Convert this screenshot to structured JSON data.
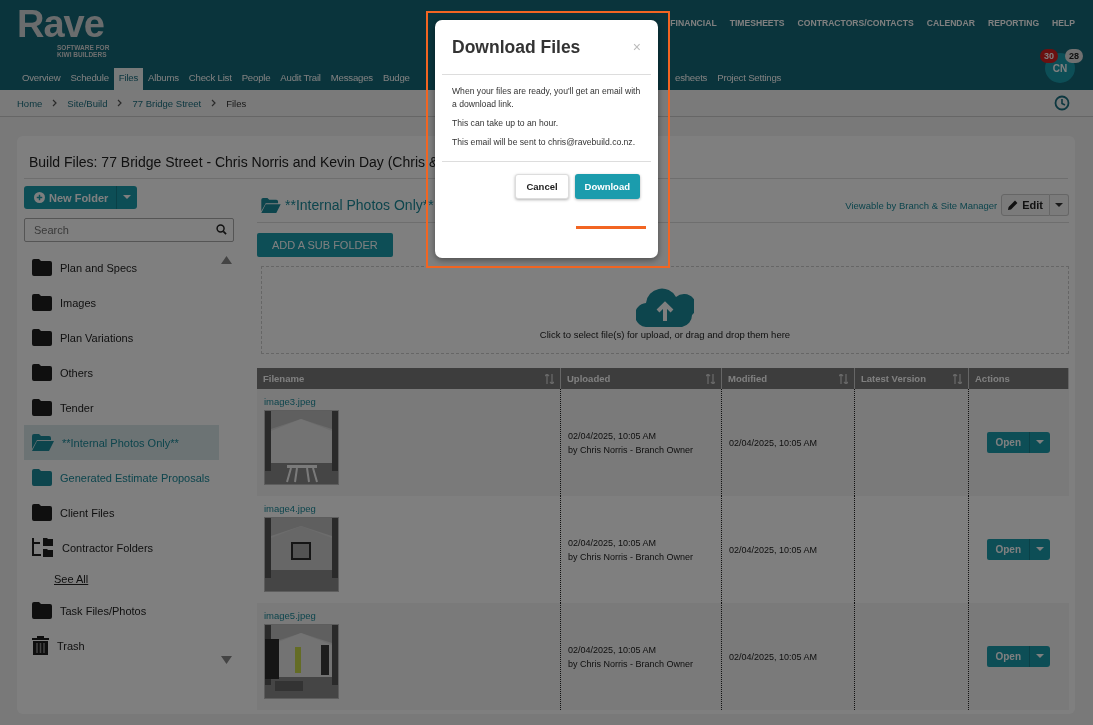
{
  "logo": {
    "name": "Rave",
    "tagline": "SOFTWARE FOR KIWI BUILDERS"
  },
  "top_menu": [
    "FINANCIAL",
    "TIMESHEETS",
    "CONTRACTORS/CONTACTS",
    "CALENDAR",
    "REPORTING",
    "HELP"
  ],
  "tabs_left": [
    {
      "label": "Overview",
      "selected": false
    },
    {
      "label": "Schedule",
      "selected": false
    },
    {
      "label": "Files",
      "selected": true
    },
    {
      "label": "Albums",
      "selected": false
    },
    {
      "label": "Check List",
      "selected": false
    },
    {
      "label": "People",
      "selected": false
    },
    {
      "label": "Audit Trail",
      "selected": false
    },
    {
      "label": "Messages",
      "selected": false
    },
    {
      "label": "Budge",
      "selected": false
    }
  ],
  "tabs_right": [
    {
      "label": "esheets",
      "selected": false
    },
    {
      "label": "Project Settings",
      "selected": false
    }
  ],
  "user": {
    "initials": "CN",
    "alerts": "30",
    "messages": "28"
  },
  "breadcrumb": [
    "Home",
    "Site/Build",
    "77 Bridge Street",
    "Files"
  ],
  "page_title": "Build Files: 77 Bridge Street - Chris Norris and Kevin Day (Chris &",
  "new_folder": "New Folder",
  "search": {
    "placeholder": "Search"
  },
  "folders": [
    {
      "label": "Plan and Specs",
      "kind": "folder",
      "selected": false
    },
    {
      "label": "Images",
      "kind": "folder",
      "selected": false
    },
    {
      "label": "Plan Variations",
      "kind": "folder",
      "selected": false
    },
    {
      "label": "Others",
      "kind": "folder",
      "selected": false
    },
    {
      "label": "Tender",
      "kind": "folder",
      "selected": false
    },
    {
      "label": "**Internal Photos Only**",
      "kind": "open-folder",
      "selected": true
    },
    {
      "label": "Generated Estimate Proposals",
      "kind": "special-folder",
      "selected": false
    },
    {
      "label": "Client Files",
      "kind": "folder",
      "selected": false
    },
    {
      "label": "Contractor Folders",
      "kind": "tree",
      "selected": false,
      "children": [
        {
          "label": "See All",
          "kind": "link",
          "selected": false
        }
      ]
    },
    {
      "label": "Task Files/Photos",
      "kind": "folder",
      "selected": false
    },
    {
      "label": "Trash",
      "kind": "trash",
      "selected": false
    }
  ],
  "folder_title": "**Internal Photos Only**",
  "visibility": "Viewable by Branch & Site Manager",
  "edit_button": "Edit",
  "add_sub_folder": "ADD A SUB FOLDER",
  "dropzone": "Click to select file(s) for upload, or drag and drop them here",
  "table": {
    "columns": [
      "Filename",
      "Uploaded",
      "Modified",
      "Latest Version",
      "Actions"
    ],
    "rows": [
      {
        "filename": "image3.jpeg",
        "uploaded": "02/04/2025, 10:05 AM",
        "uploaded_by": "by Chris Norris - Branch Owner",
        "modified": "02/04/2025, 10:05 AM",
        "action": "Open"
      },
      {
        "filename": "image4.jpeg",
        "uploaded": "02/04/2025, 10:05 AM",
        "uploaded_by": "by Chris Norris - Branch Owner",
        "modified": "02/04/2025, 10:05 AM",
        "action": "Open"
      },
      {
        "filename": "image5.jpeg",
        "uploaded": "02/04/2025, 10:05 AM",
        "uploaded_by": "by Chris Norris - Branch Owner",
        "modified": "02/04/2025, 10:05 AM",
        "action": "Open"
      }
    ]
  },
  "dialog": {
    "title": "Download Files",
    "close": "×",
    "paragraphs": [
      "When your files are ready, you'll get an email with a download link.",
      "This can take up to an hour.",
      "This email will be sent to chris@ravebuild.co.nz."
    ],
    "buttons": [
      {
        "label": "Cancel",
        "kind": "secondary"
      },
      {
        "label": "Download",
        "kind": "primary"
      }
    ]
  }
}
